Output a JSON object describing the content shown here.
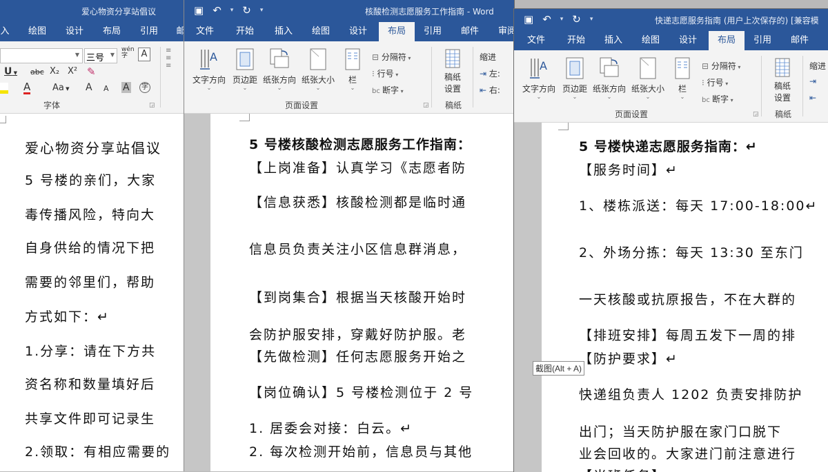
{
  "colors": {
    "word_blue": "#2b579a",
    "ribbon_bg": "#f3f3f3",
    "spell_underline": "#4a7fd0"
  },
  "w1": {
    "title": "爱心物资分享站倡议",
    "tabs": [
      "入",
      "绘图",
      "设计",
      "布局",
      "引用",
      "邮"
    ],
    "font_size_value": "三号",
    "group_font": "字体",
    "fmt_icons": [
      "underline-icon",
      "strikethrough-icon",
      "subscript-icon",
      "superscript-icon",
      "clear-format-icon",
      "highlight-icon",
      "font-color-icon",
      "change-case-icon",
      "grow-font-icon",
      "shrink-font-icon",
      "char-shading-icon",
      "enclose-char-icon",
      "wen-icon",
      "char-border-icon"
    ],
    "fmt": {
      "u": "U",
      "abc": "abc",
      "x2": "X₂",
      "x2up": "X²",
      "aa": "Aa",
      "a": "A",
      "wen": "wén",
      "zi": "字"
    },
    "lines": [
      "爱心物资分享站倡议",
      "5 号楼的亲们，大家",
      "毒传播风险，特向大",
      "自身供给的情况下把",
      "需要的邻里们，帮助",
      "方式如下：↵",
      "1.分享：请在下方共",
      "资名称和数量填好后",
      "共享文件即可记录生",
      "2.领取：有相应需要的"
    ]
  },
  "w2": {
    "title": "核酸检测志愿服务工作指南  -  Word",
    "tabs": [
      "文件",
      "开始",
      "插入",
      "绘图",
      "设计",
      "布局",
      "引用",
      "邮件",
      "审阅"
    ],
    "btns": {
      "direction": "文字方向",
      "margins": "页边距",
      "orientation": "纸张方向",
      "size": "纸张大小",
      "columns": "栏"
    },
    "rows": [
      "分隔符",
      "行号",
      "断字"
    ],
    "indent_label": "缩进",
    "indent_rows": [
      "左:",
      "右:"
    ],
    "manuscript": [
      "稿纸",
      "设置"
    ],
    "group_page_setup": "页面设置",
    "group_manuscript": "稿纸",
    "lines": [
      "5 号楼核酸检测志愿服务工作指南：",
      "【上岗准备】认真学习《志愿者防",
      "【信息获悉】核酸检测都是临时通",
      "信息员负责关注小区信息群消息，",
      "【到岗集合】根据当天核酸开始时",
      "会防护服安排，穿戴好防护服。老",
      "【先做检测】任何志愿服务开始之",
      "【岗位确认】5 号楼检测位于 2 号",
      "1.  居委会对接：白云。↵",
      "2.  每次检测开始前，信息员与其他"
    ]
  },
  "w3": {
    "title": "快递志愿服务指南 (用户上次保存的) [兼容模",
    "tabs": [
      "文件",
      "开始",
      "插入",
      "绘图",
      "设计",
      "布局",
      "引用",
      "邮件"
    ],
    "btns": {
      "direction": "文字方向",
      "margins": "页边距",
      "orientation": "纸张方向",
      "size": "纸张大小",
      "columns": "栏"
    },
    "rows": [
      "分隔符",
      "行号",
      "断字"
    ],
    "indent_label": "缩进",
    "manuscript": [
      "稿纸",
      "设置"
    ],
    "group_page_setup": "页面设置",
    "group_manuscript": "稿纸",
    "lines": [
      "5 号楼快递志愿服务指南：↵",
      "【服务时间】↵",
      "1、楼栋派送：每天 17:00-18:00↵",
      "2、外场分拣：每天  13:30  至东门",
      "一天核酸或抗原报告，不在大群的",
      "【排班安排】每周五发下一周的排",
      "【防护要求】↵",
      "快递组负责人 1202 负责安排防护",
      "出门；当天防护服在家门口脱下",
      "业会回收的。大家进门前注意进行",
      "【当班任务】"
    ]
  },
  "tooltip": "截图(Alt + A)"
}
